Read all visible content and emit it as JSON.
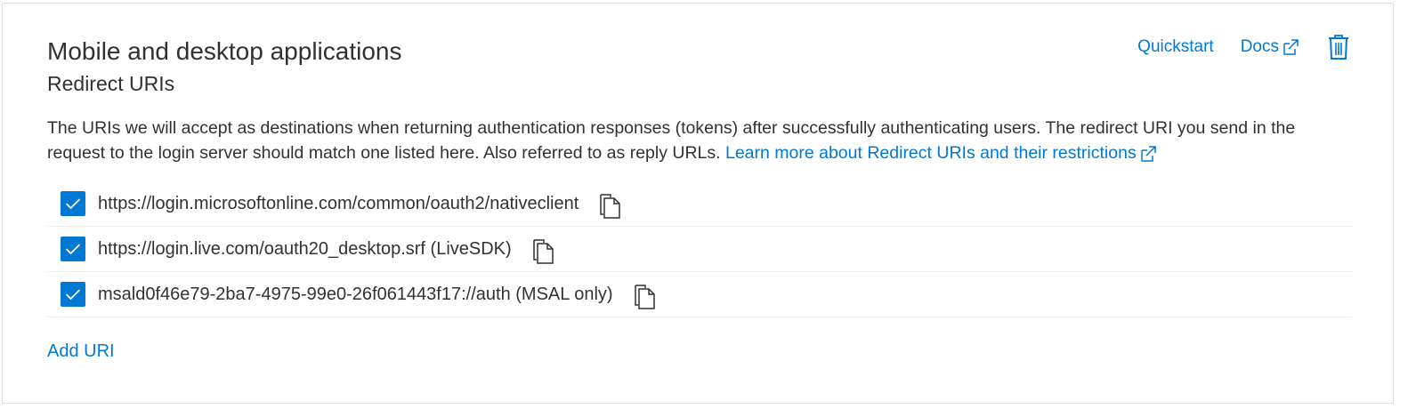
{
  "section": {
    "title": "Mobile and desktop applications",
    "subtitle": "Redirect URIs",
    "quickstart_label": "Quickstart",
    "docs_label": "Docs",
    "delete_icon": "trash-icon",
    "description_text": "The URIs we will accept as destinations when returning authentication responses (tokens) after successfully authenticating users. The redirect URI you send in the request to the login server should match one listed here. Also referred to as reply URLs.",
    "learn_more_label": "Learn more about Redirect URIs and their restrictions",
    "add_uri_label": "Add URI"
  },
  "uris": [
    {
      "label": "https://login.microsoftonline.com/common/oauth2/nativeclient",
      "checked": true
    },
    {
      "label": "https://login.live.com/oauth20_desktop.srf (LiveSDK)",
      "checked": true
    },
    {
      "label": "msald0f46e79-2ba7-4975-99e0-26f061443f17://auth (MSAL only)",
      "checked": true
    }
  ],
  "colors": {
    "accent": "#0078d4",
    "text": "#323130",
    "border": "#e1dfdd"
  }
}
